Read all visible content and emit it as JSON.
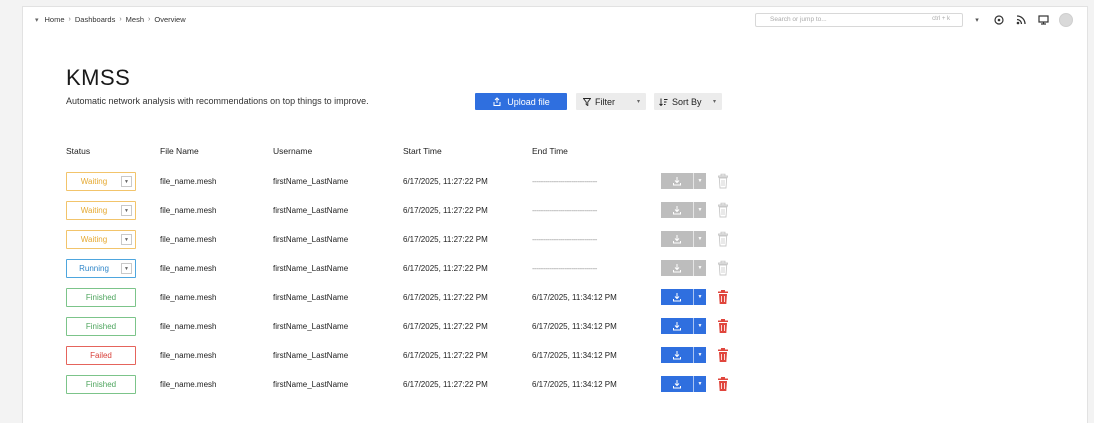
{
  "breadcrumb": [
    "Home",
    "Dashboards",
    "Mesh",
    "Overview"
  ],
  "search": {
    "placeholder": "Search or jump to...",
    "shortcut": "ctrl + k"
  },
  "header_icons": [
    "chevron-down-icon",
    "help-icon",
    "rss-icon",
    "monitor-icon",
    "avatar"
  ],
  "title": "KMSS",
  "subtitle": "Automatic network analysis with recommendations on top things to improve.",
  "toolbar": {
    "upload_label": "Upload file",
    "filter_label": "Filter",
    "sort_label": "Sort By"
  },
  "columns": {
    "status": "Status",
    "file_name": "File Name",
    "username": "Username",
    "start_time": "Start Time",
    "end_time": "End Time"
  },
  "rows": [
    {
      "status": "Waiting",
      "file": "file_name.mesh",
      "user": "firstName_LastName",
      "start": "6/17/2025, 11:27:22 PM",
      "end": "------------------------------",
      "actions_enabled": false
    },
    {
      "status": "Waiting",
      "file": "file_name.mesh",
      "user": "firstName_LastName",
      "start": "6/17/2025, 11:27:22 PM",
      "end": "------------------------------",
      "actions_enabled": false
    },
    {
      "status": "Waiting",
      "file": "file_name.mesh",
      "user": "firstName_LastName",
      "start": "6/17/2025, 11:27:22 PM",
      "end": "------------------------------",
      "actions_enabled": false
    },
    {
      "status": "Running",
      "file": "file_name.mesh",
      "user": "firstName_LastName",
      "start": "6/17/2025, 11:27:22 PM",
      "end": "------------------------------",
      "actions_enabled": false
    },
    {
      "status": "Finished",
      "file": "file_name.mesh",
      "user": "firstName_LastName",
      "start": "6/17/2025, 11:27:22 PM",
      "end": "6/17/2025, 11:34:12 PM",
      "actions_enabled": true
    },
    {
      "status": "Finished",
      "file": "file_name.mesh",
      "user": "firstName_LastName",
      "start": "6/17/2025, 11:27:22 PM",
      "end": "6/17/2025, 11:34:12 PM",
      "actions_enabled": true
    },
    {
      "status": "Failed",
      "file": "file_name.mesh",
      "user": "firstName_LastName",
      "start": "6/17/2025, 11:27:22 PM",
      "end": "6/17/2025, 11:34:12 PM",
      "actions_enabled": true
    },
    {
      "status": "Finished",
      "file": "file_name.mesh",
      "user": "firstName_LastName",
      "start": "6/17/2025, 11:27:22 PM",
      "end": "6/17/2025, 11:34:12 PM",
      "actions_enabled": true
    }
  ],
  "colors": {
    "primary": "#2f6fdf",
    "waiting": "#e5a931",
    "running": "#2f86c9",
    "finished": "#4ea55e",
    "failed": "#d8413a",
    "disabled": "#bdbdbd"
  }
}
